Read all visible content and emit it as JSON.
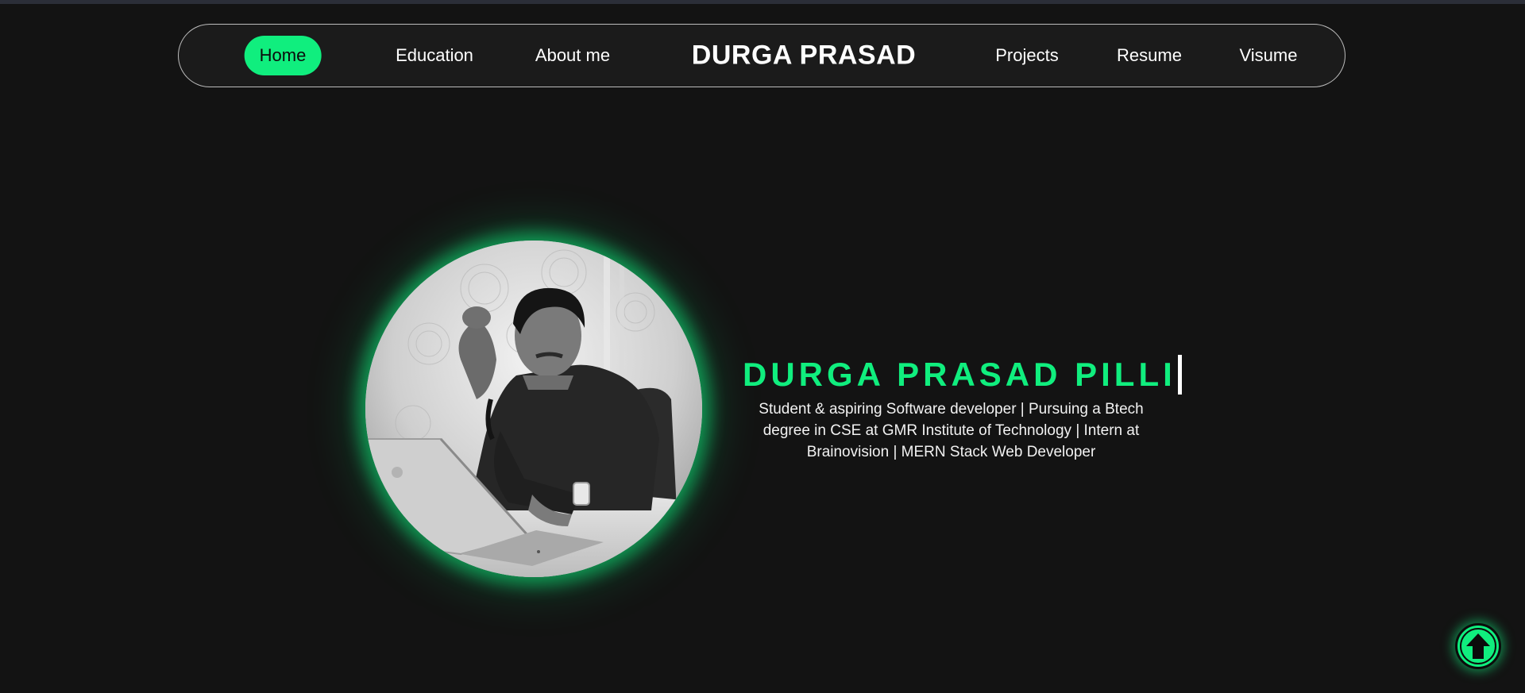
{
  "nav": {
    "left_items": [
      {
        "label": "Home",
        "active": true
      },
      {
        "label": "Education",
        "active": false
      },
      {
        "label": "About me",
        "active": false
      }
    ],
    "brand": "DURGA PRASAD",
    "right_items": [
      {
        "label": "Projects"
      },
      {
        "label": "Resume"
      },
      {
        "label": "Visume"
      }
    ]
  },
  "hero": {
    "name": "DURGA PRASAD PILLI",
    "tagline": "Student & aspiring Software developer | Pursuing a Btech degree in CSE at GMR Institute of Technology | Intern at Brainovision | MERN Stack Web Developer",
    "photo_icon": "profile-photo"
  },
  "scroll_top": {
    "icon": "arrow-up-icon"
  },
  "colors": {
    "accent": "#10ee7e",
    "background": "#131313",
    "navbar_bg": "#1b1b1b",
    "text": "#ffffff"
  }
}
